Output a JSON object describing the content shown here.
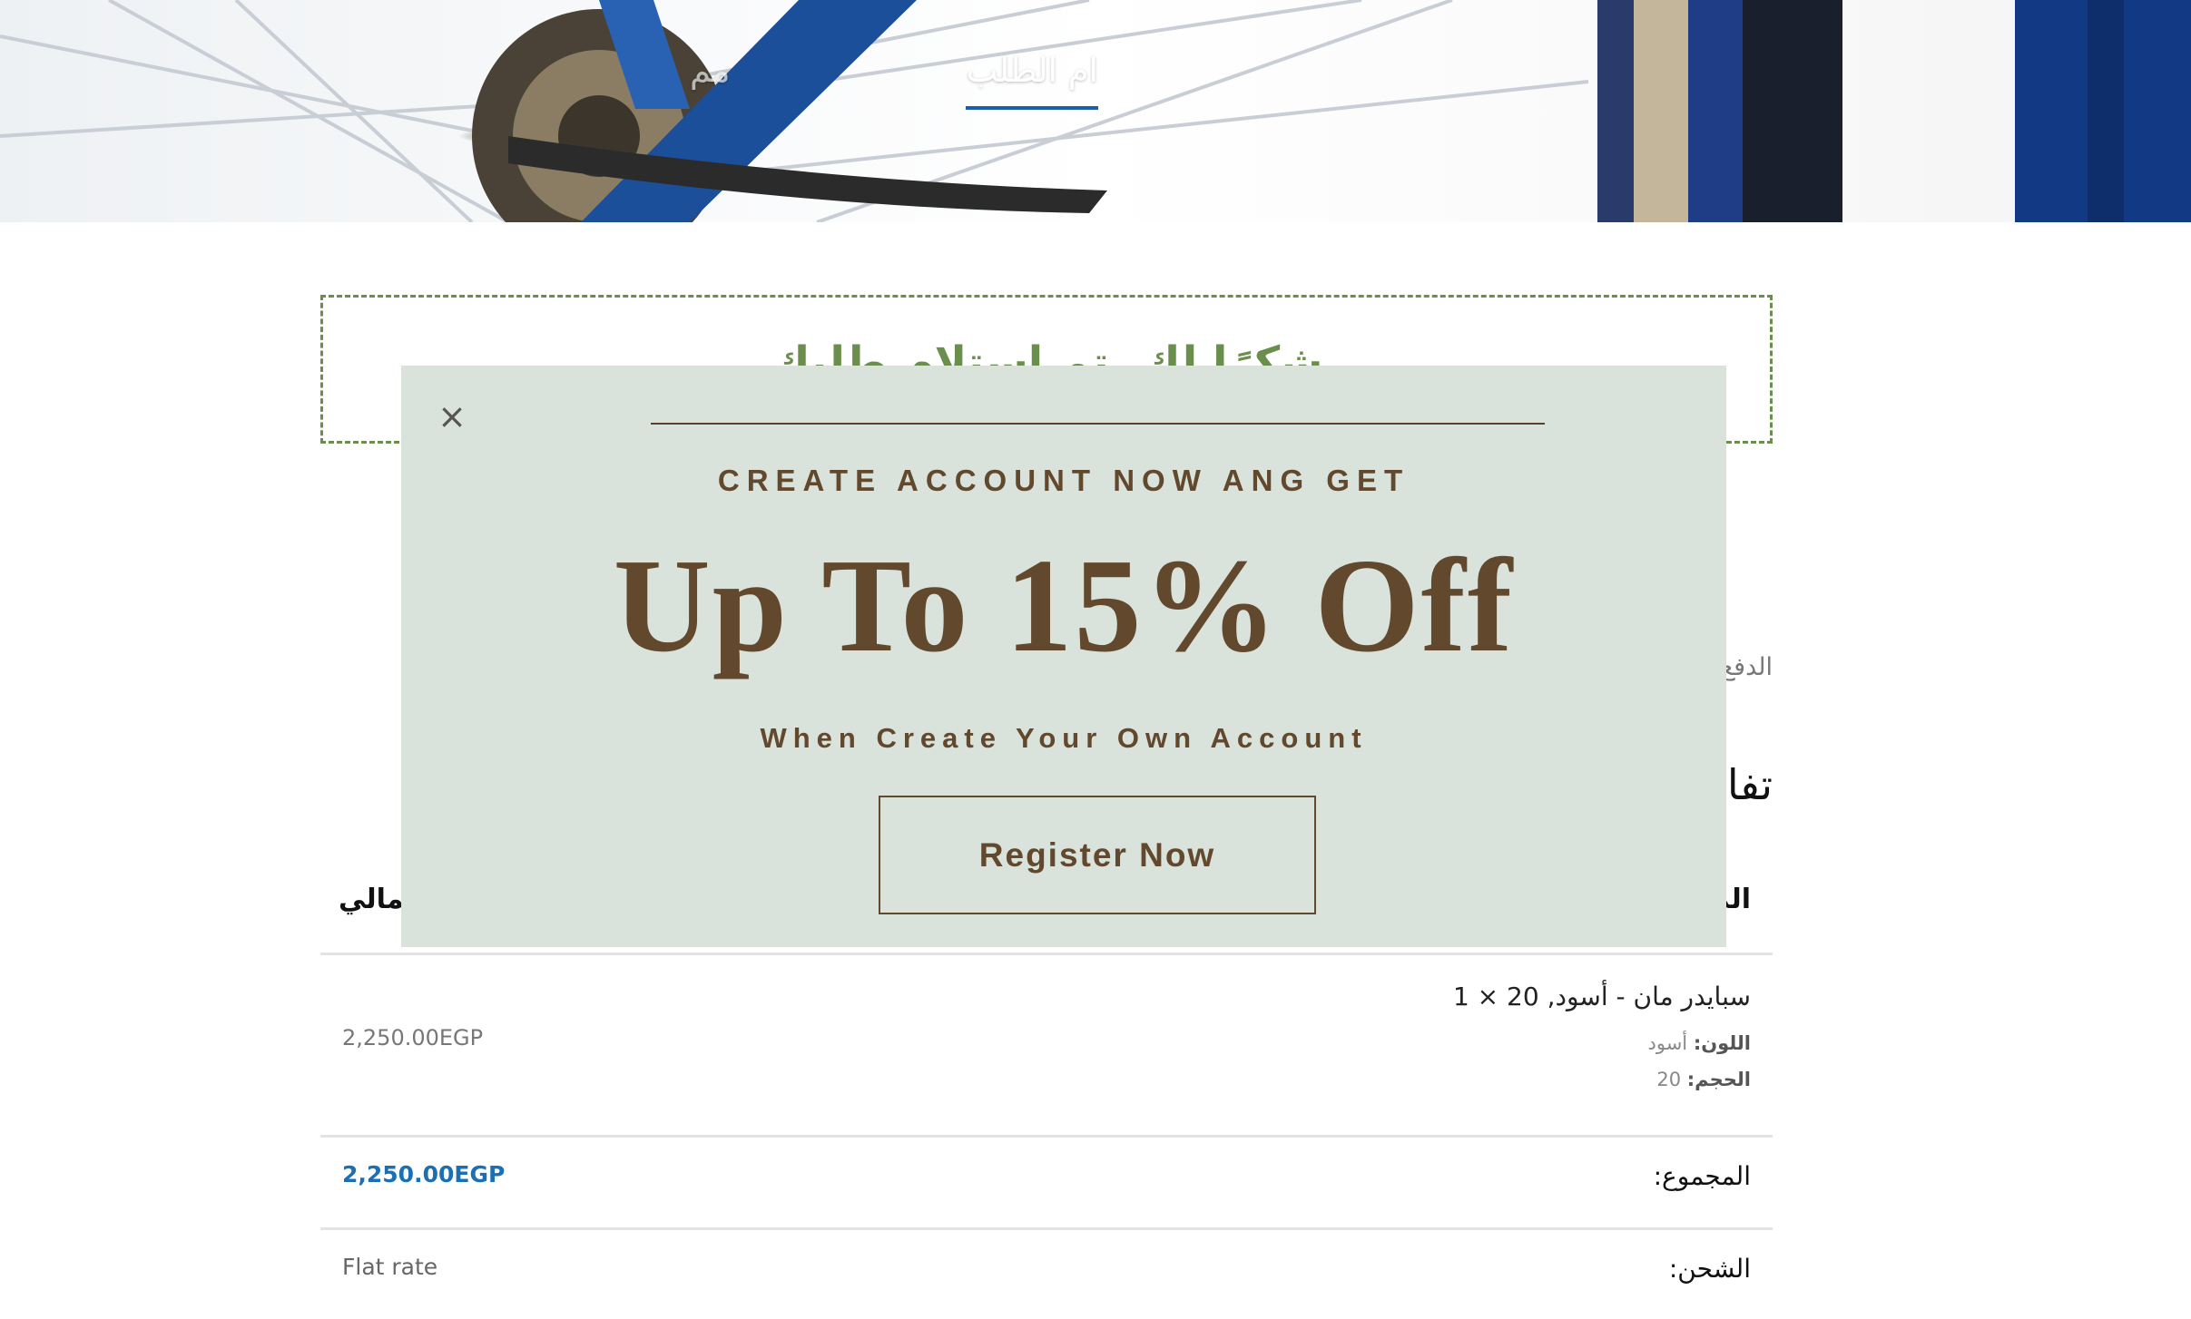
{
  "hero": {
    "tabs": [
      {
        "label": "ام الطلب",
        "active": true
      },
      {
        "label": "مم",
        "active": false
      }
    ],
    "accent_color": "#1a5fae"
  },
  "thanks": {
    "message": "شكرًا لك. تم استلام طلبك",
    "border_color": "#6a8f4c"
  },
  "order": {
    "payment_label": "الدفع",
    "details_heading": "تفا",
    "columns": {
      "product": "الم",
      "total": "حمالي"
    },
    "item": {
      "name": "سبايدر مان - أسود, 20 × 1",
      "meta": [
        {
          "key": "اللون:",
          "value": "أسود"
        },
        {
          "key": "الحجم:",
          "value": "20"
        }
      ],
      "price": "2,250.00EGP"
    },
    "subtotal": {
      "label": "المجموع:",
      "value": "2,250.00EGP"
    },
    "shipping": {
      "label": "الشحن:",
      "value": "Flat rate"
    }
  },
  "popup": {
    "close_icon": "×",
    "kicker": "CREATE ACCOUNT NOW ANG GET",
    "headline": "Up To 15% Off",
    "subheading": "When Create Your Own Account",
    "cta_label": "Register Now",
    "background_color": "#d9e3dc",
    "text_color": "#62482d"
  }
}
